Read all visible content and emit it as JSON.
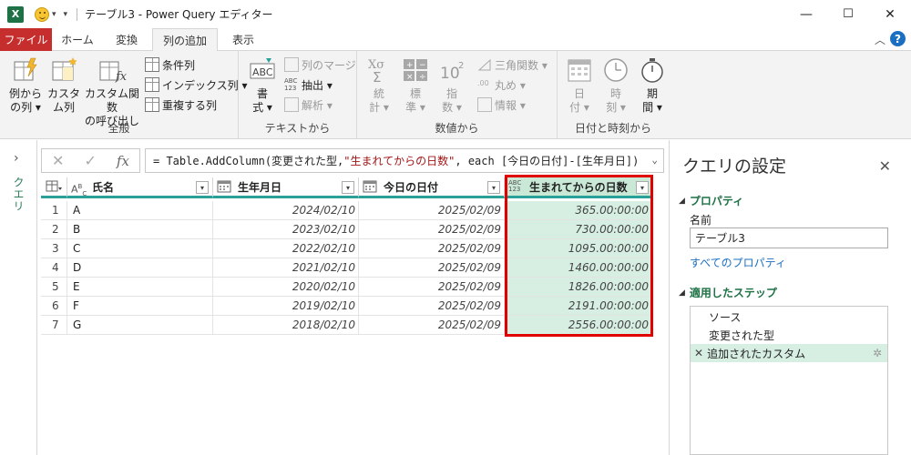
{
  "titlebar": {
    "title": "テーブル3 - Power Query エディター",
    "app_icon": "excel-icon",
    "minimize": "—",
    "maximize": "☐",
    "close": "✕"
  },
  "tabs": [
    {
      "label": "ファイル"
    },
    {
      "label": "ホーム"
    },
    {
      "label": "変換"
    },
    {
      "label": "列の追加"
    },
    {
      "label": "表示"
    }
  ],
  "ribbon": {
    "groups": {
      "general": {
        "label": "全般",
        "col_from_example": [
          "例から",
          "の列 ▾"
        ],
        "custom_col": [
          "カスタ",
          "ム列"
        ],
        "invoke_custom_fn": [
          "カスタム関数",
          "の呼び出し"
        ],
        "conditional_col": "条件列",
        "index_col": "インデックス列 ▾",
        "duplicate_col": "重複する列"
      },
      "text": {
        "label": "テキストから",
        "format": [
          "書",
          "式 ▾"
        ],
        "merge_cols": "列のマージ",
        "extract": "抽出 ▾",
        "parse": "解析 ▾"
      },
      "number": {
        "label": "数値から",
        "statistics": [
          "統",
          "計 ▾"
        ],
        "standard": [
          "標",
          "準 ▾"
        ],
        "scientific": [
          "指",
          "数 ▾"
        ],
        "trig": "三角関数 ▾",
        "rounding": "丸め ▾",
        "information": "情報 ▾"
      },
      "datetime": {
        "label": "日付と時刻から",
        "date": [
          "日",
          "付 ▾"
        ],
        "time": [
          "時",
          "刻 ▾"
        ],
        "duration": [
          "期",
          "間 ▾"
        ]
      }
    }
  },
  "left_pane": {
    "label": "クエリ",
    "expand": "›"
  },
  "formula_bar": {
    "cancel": "✕",
    "confirm": "✓",
    "fx": "fx",
    "formula_prefix": "= Table.AddColumn(変更された型, ",
    "formula_string": "\"生まれてからの日数\"",
    "formula_suffix": ", each [今日の日付]-[生年月日])",
    "expand": "⌄"
  },
  "grid": {
    "columns": [
      {
        "name": "氏名",
        "type": "text"
      },
      {
        "name": "生年月日",
        "type": "date"
      },
      {
        "name": "今日の日付",
        "type": "date"
      },
      {
        "name": "生まれてからの日数",
        "type": "any"
      }
    ],
    "rows": [
      {
        "n": "1",
        "name": "A",
        "birth": "2024/02/10",
        "today": "2025/02/09",
        "days": "365.00:00:00"
      },
      {
        "n": "2",
        "name": "B",
        "birth": "2023/02/10",
        "today": "2025/02/09",
        "days": "730.00:00:00"
      },
      {
        "n": "3",
        "name": "C",
        "birth": "2022/02/10",
        "today": "2025/02/09",
        "days": "1095.00:00:00"
      },
      {
        "n": "4",
        "name": "D",
        "birth": "2021/02/10",
        "today": "2025/02/09",
        "days": "1460.00:00:00"
      },
      {
        "n": "5",
        "name": "E",
        "birth": "2020/02/10",
        "today": "2025/02/09",
        "days": "1826.00:00:00"
      },
      {
        "n": "6",
        "name": "F",
        "birth": "2019/02/10",
        "today": "2025/02/09",
        "days": "2191.00:00:00"
      },
      {
        "n": "7",
        "name": "G",
        "birth": "2018/02/10",
        "today": "2025/02/09",
        "days": "2556.00:00:00"
      }
    ]
  },
  "settings": {
    "title": "クエリの設定",
    "close": "✕",
    "properties_header": "プロパティ",
    "name_label": "名前",
    "name_value": "テーブル3",
    "all_properties": "すべてのプロパティ",
    "steps_header": "適用したステップ",
    "steps": [
      {
        "label": "ソース",
        "selected": false
      },
      {
        "label": "変更された型",
        "selected": false
      },
      {
        "label": "追加されたカスタム",
        "selected": true
      }
    ]
  },
  "colors": {
    "file_tab": "#c62d2d",
    "accent_green": "#1e7145",
    "header_underline": "#2aa198",
    "selection": "#d7efe2",
    "highlight_box": "#e00000"
  }
}
